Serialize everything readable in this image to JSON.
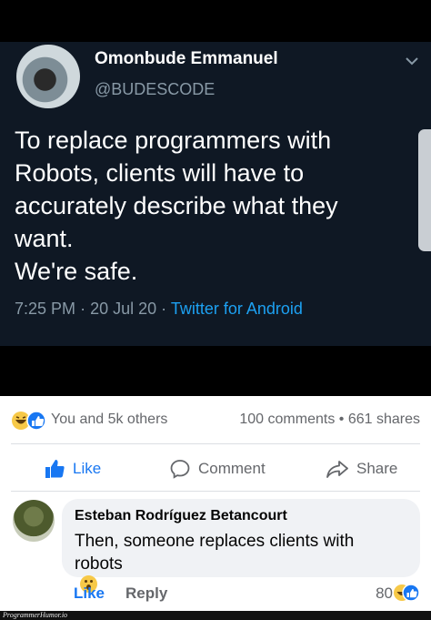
{
  "tweet": {
    "author_name": "Omonbude Emmanuel",
    "handle": "@BUDESCODE",
    "text_lines": [
      "To replace programmers with",
      "Robots, clients will have to",
      "accurately describe what they",
      "want.",
      "We're safe."
    ],
    "time": "7:25 PM",
    "date": "20 Jul 20",
    "separator": "·",
    "source": "Twitter for Android"
  },
  "post": {
    "reactions_label": "You and 5k others",
    "comments_count": "100 comments",
    "stats_separator": "•",
    "shares_count": "661 shares",
    "actions": {
      "like": "Like",
      "comment": "Comment",
      "share": "Share"
    }
  },
  "comment": {
    "author": "Esteban Rodríguez Betancourt",
    "text_lines": [
      "Then, someone replaces clients with",
      "robots"
    ],
    "like_label": "Like",
    "reply_label": "Reply",
    "reaction_count": "80"
  },
  "watermark": "ProgrammerHumor.io",
  "colors": {
    "tweet_background": "#0f1824",
    "tweet_link": "#1da1f2",
    "facebook_blue": "#1877f2",
    "muted_text": "#65676b"
  },
  "icons": [
    "chevron-down-icon",
    "haha-reaction-icon",
    "like-reaction-icon",
    "thumbs-up-icon",
    "comment-bubble-icon",
    "share-arrow-icon",
    "wow-emoji-icon"
  ]
}
